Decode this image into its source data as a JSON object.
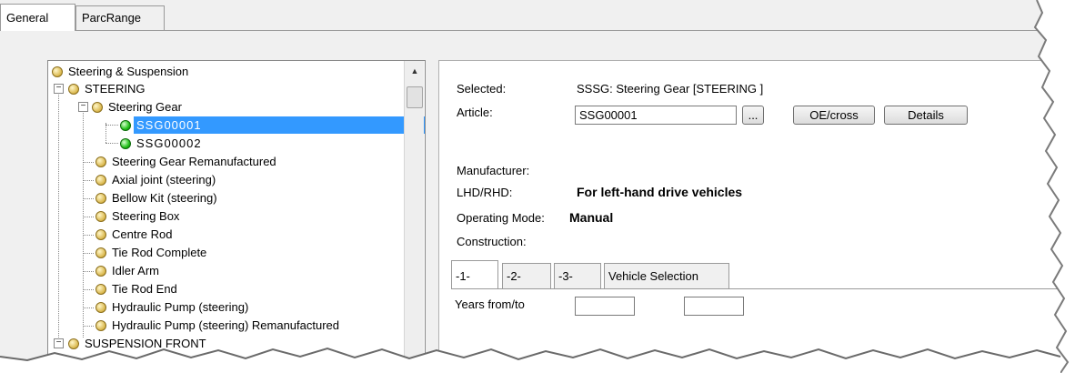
{
  "tabs": {
    "general": "General",
    "parc_range": "ParcRange"
  },
  "tree": {
    "items": [
      {
        "label": "Steering & Suspension"
      },
      {
        "label": "STEERING"
      },
      {
        "label": "Steering Gear"
      },
      {
        "label": "SSG00001"
      },
      {
        "label": "SSG00002"
      },
      {
        "label": "Steering Gear Remanufactured"
      },
      {
        "label": "Axial joint (steering)"
      },
      {
        "label": "Bellow Kit (steering)"
      },
      {
        "label": "Steering Box"
      },
      {
        "label": "Centre Rod"
      },
      {
        "label": "Tie Rod Complete"
      },
      {
        "label": "Idler Arm"
      },
      {
        "label": "Tie Rod End"
      },
      {
        "label": "Hydraulic Pump (steering)"
      },
      {
        "label": "Hydraulic Pump (steering) Remanufactured"
      },
      {
        "label": "SUSPENSION FRONT"
      }
    ],
    "selected": "SSG00001",
    "expander_minus": "−",
    "scroll_up": "▲"
  },
  "detail": {
    "selected_label": "Selected:",
    "selected_value": "SSSG: Steering Gear [STEERING ]",
    "article_label": "Article:",
    "article_value": "SSG00001",
    "browse_button": "...",
    "oe_cross_button": "OE/cross",
    "details_button": "Details",
    "manufacturer_label": "Manufacturer:",
    "lhd_rhd_label": "LHD/RHD:",
    "lhd_rhd_value": "For left-hand drive vehicles",
    "operating_mode_label": "Operating Mode:",
    "operating_mode_value": "Manual",
    "construction_label": "Construction:",
    "inner_tabs": [
      "-1-",
      "-2-",
      "-3-",
      "Vehicle Selection"
    ],
    "years_label": "Years from/to",
    "year_from": "",
    "year_to": ""
  }
}
